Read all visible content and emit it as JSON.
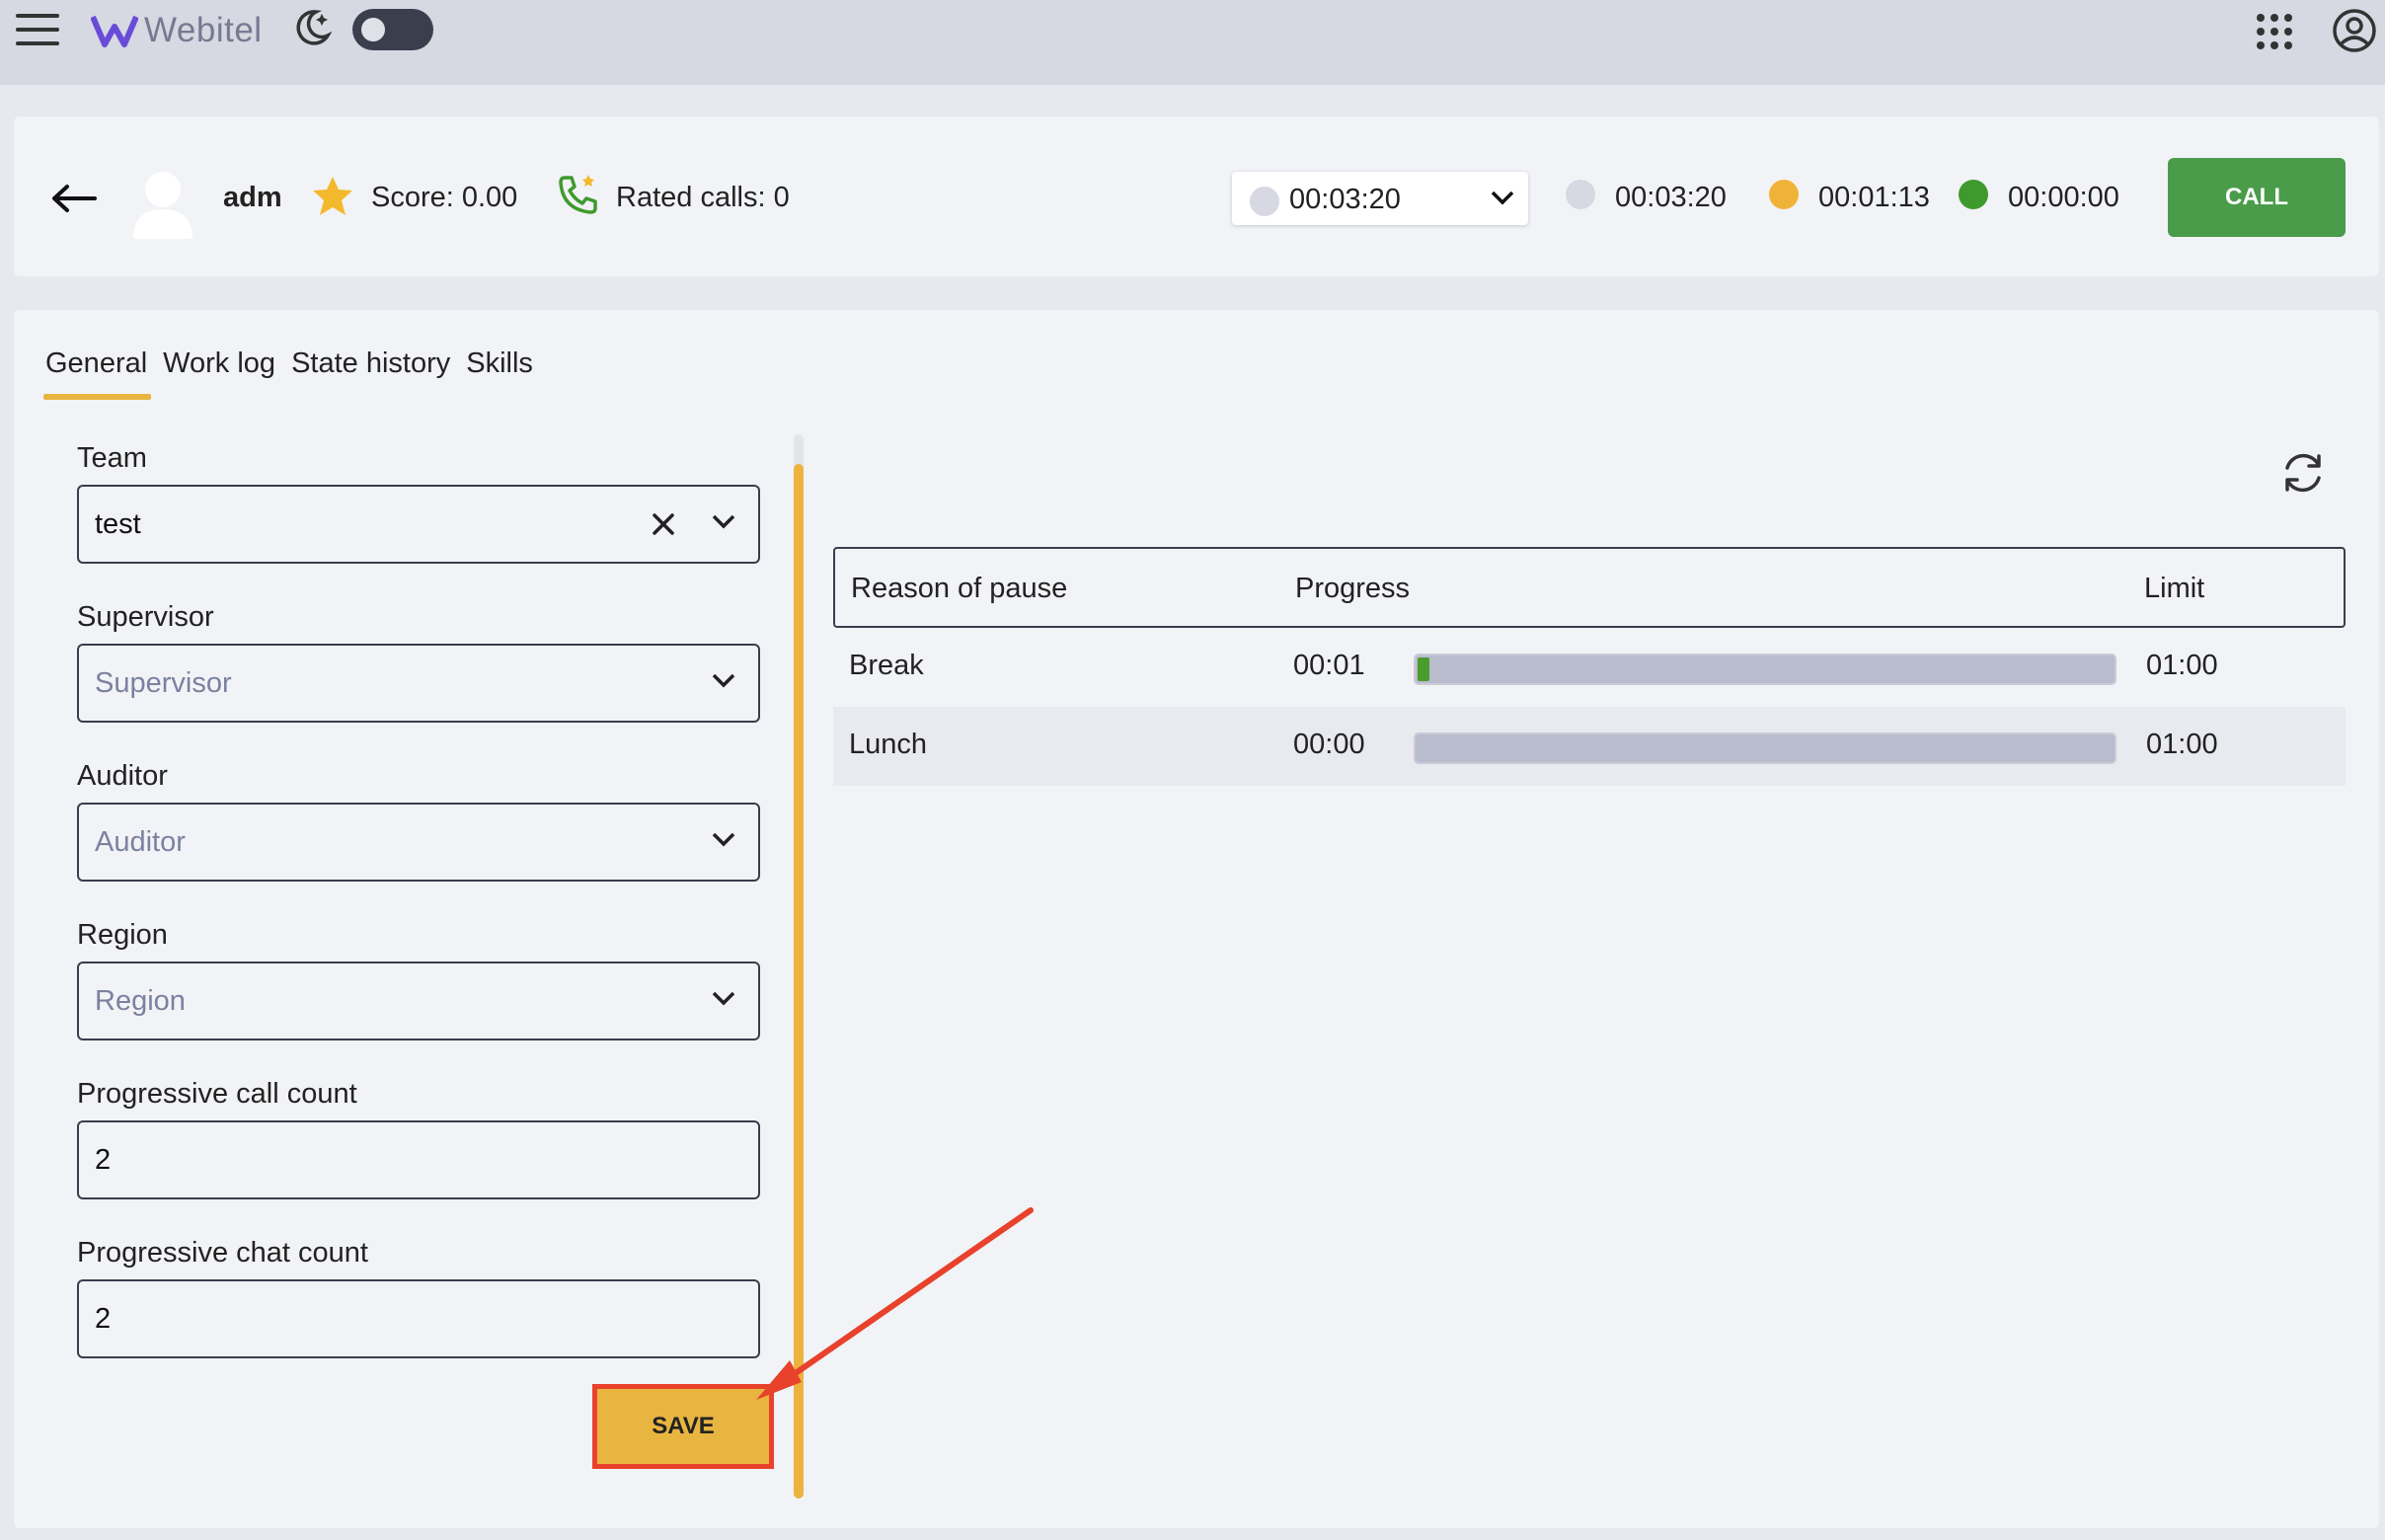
{
  "app": {
    "brand": "Webitel"
  },
  "agent": {
    "name": "adm",
    "score": "Score: 0.00",
    "rated_calls": "Rated calls: 0",
    "status_select_value": "00:03:20",
    "timers": [
      {
        "value": "00:03:20",
        "color": "#d7d8e2"
      },
      {
        "value": "00:01:13",
        "color": "#f0b33a"
      },
      {
        "value": "00:00:00",
        "color": "#3f9a2e"
      }
    ],
    "call_label": "CALL"
  },
  "tabs": [
    {
      "label": "General",
      "active": true
    },
    {
      "label": "Work log",
      "active": false
    },
    {
      "label": "State history",
      "active": false
    },
    {
      "label": "Skills",
      "active": false
    }
  ],
  "form": {
    "team": {
      "label": "Team",
      "value": "test"
    },
    "supervisor": {
      "label": "Supervisor",
      "placeholder": "Supervisor"
    },
    "auditor": {
      "label": "Auditor",
      "placeholder": "Auditor"
    },
    "region": {
      "label": "Region",
      "placeholder": "Region"
    },
    "progressive_call_count": {
      "label": "Progressive call count",
      "value": "2"
    },
    "progressive_chat_count": {
      "label": "Progressive chat count",
      "value": "2"
    },
    "save_label": "SAVE"
  },
  "pause_table": {
    "headers": {
      "reason": "Reason of pause",
      "progress": "Progress",
      "limit": "Limit"
    },
    "rows": [
      {
        "reason": "Break",
        "progress": "00:01",
        "limit": "01:00",
        "fraction": 0.017
      },
      {
        "reason": "Lunch",
        "progress": "00:00",
        "limit": "01:00",
        "fraction": 0
      }
    ]
  },
  "colors": {
    "accent": "#e8b540",
    "call_green": "#4a9c4a",
    "annotation_red": "#e8412c"
  }
}
